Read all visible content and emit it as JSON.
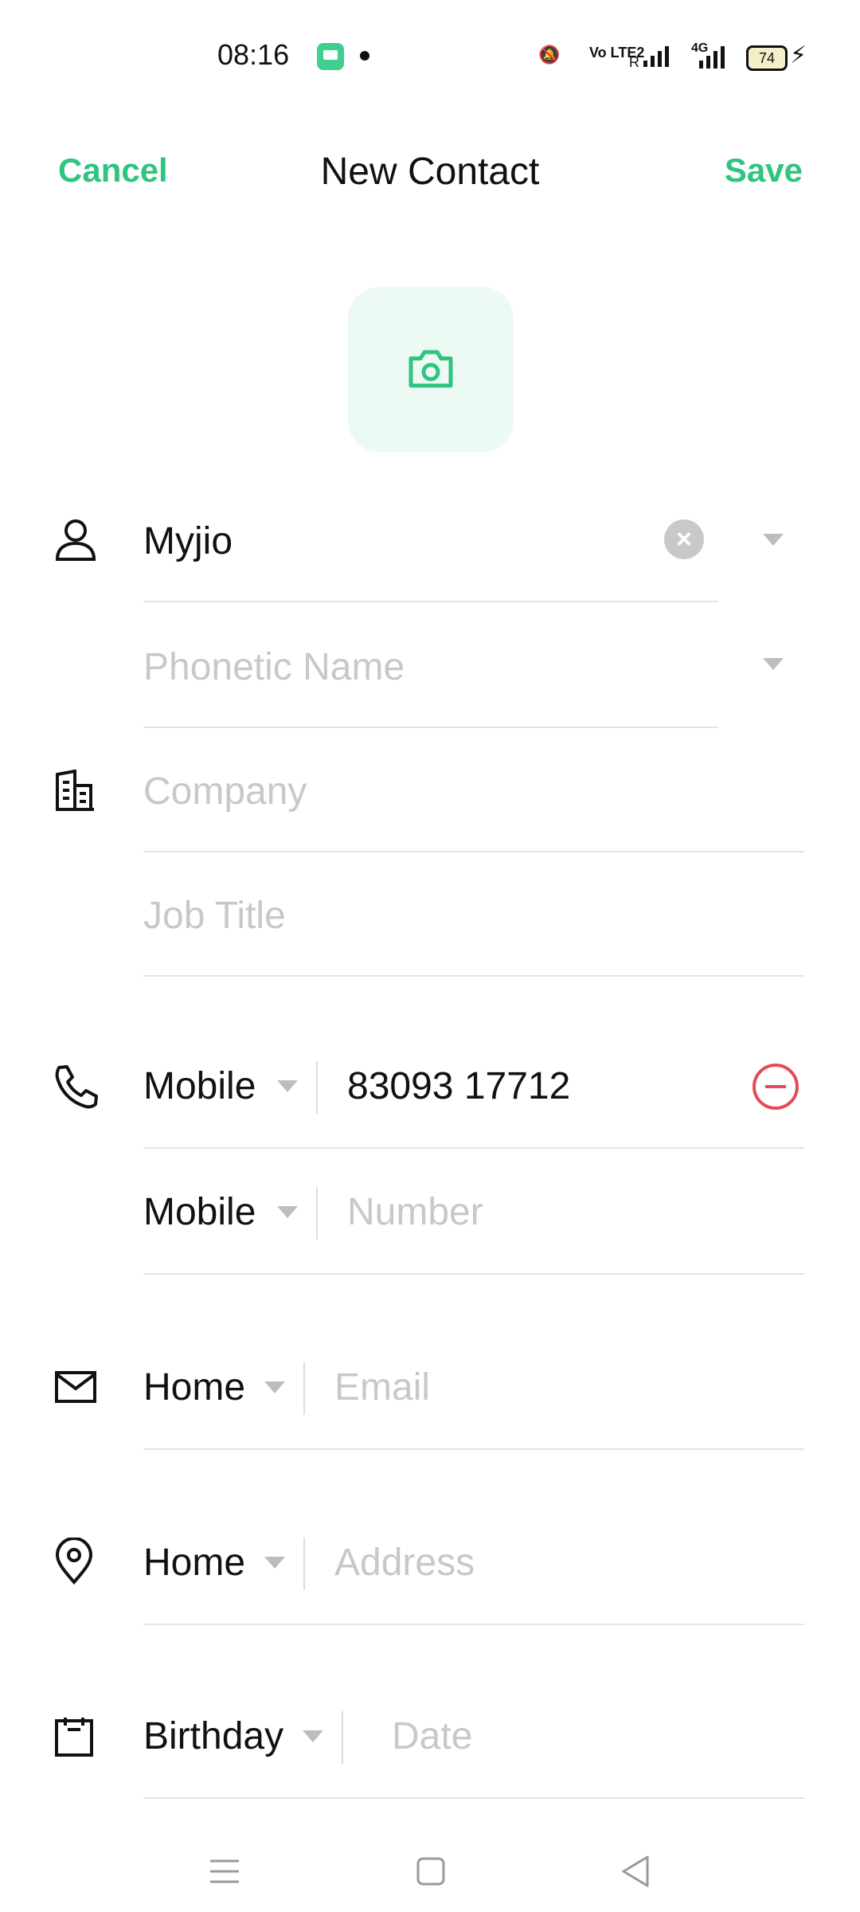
{
  "status": {
    "time": "08:16",
    "battery": "74",
    "network_tags": [
      "Vo LTE2",
      "R",
      "4G"
    ]
  },
  "header": {
    "cancel": "Cancel",
    "title": "New Contact",
    "save": "Save"
  },
  "name": {
    "value": "Myjio",
    "phonetic_placeholder": "Phonetic Name"
  },
  "company": {
    "company_placeholder": "Company",
    "job_title_placeholder": "Job Title"
  },
  "phones": [
    {
      "type": "Mobile",
      "number": "83093 17712"
    },
    {
      "type": "Mobile",
      "number_placeholder": "Number"
    }
  ],
  "email": {
    "type": "Home",
    "placeholder": "Email"
  },
  "address": {
    "type": "Home",
    "placeholder": "Address"
  },
  "date": {
    "type": "Birthday",
    "placeholder": "Date"
  },
  "icons": [
    "camera-icon",
    "person-icon",
    "building-icon",
    "phone-icon",
    "mail-icon",
    "location-icon",
    "calendar-icon",
    "menu-icon",
    "home-icon",
    "back-icon"
  ],
  "colors": {
    "accent": "#2fc47f",
    "danger": "#e54a5a",
    "placeholder": "#c8c8c8"
  }
}
